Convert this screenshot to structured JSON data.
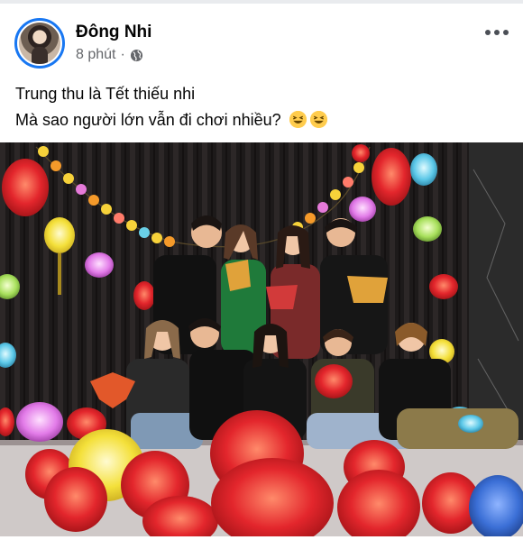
{
  "post": {
    "author_name": "Đông Nhi",
    "timestamp": "8 phút",
    "separator": "·",
    "audience_icon": "globe-icon",
    "more_icon": "more-horizontal-icon",
    "caption_line1": "Trung thu là Tết thiếu nhi",
    "caption_line2": "Mà sao người lớn vẫn đi chơi nhiều?",
    "caption_emojis": [
      "laughing-squint-emoji",
      "laughing-squint-emoji"
    ]
  },
  "colors": {
    "name": "#050505",
    "meta": "#65676b",
    "avatar_ring": "#1877f2",
    "lantern_red": "#e3262c",
    "lantern_yellow": "#f4e03a",
    "lantern_blue": "#3b6fd6"
  },
  "photo": {
    "subject": "group-photo-mid-autumn-lanterns"
  }
}
